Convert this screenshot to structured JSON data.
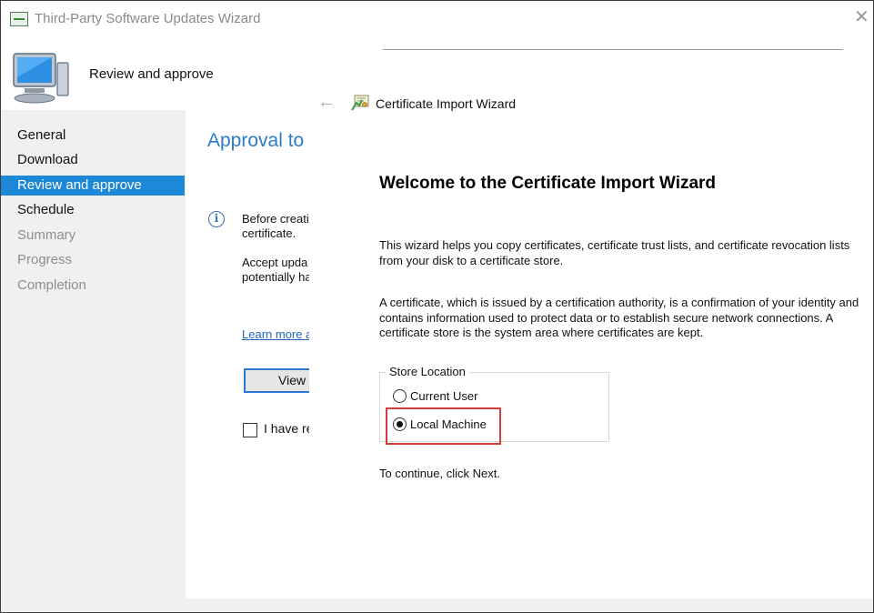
{
  "back_window": {
    "title": "Third-Party Software Updates Wizard",
    "close_glyph": "✕",
    "heading": "Review and approve",
    "nav": [
      {
        "label": "General",
        "state": "normal"
      },
      {
        "label": "Download",
        "state": "normal"
      },
      {
        "label": "Review and approve",
        "state": "active"
      },
      {
        "label": "Schedule",
        "state": "normal"
      },
      {
        "label": "Summary",
        "state": "disabled"
      },
      {
        "label": "Progress",
        "state": "disabled"
      },
      {
        "label": "Completion",
        "state": "disabled"
      }
    ],
    "main": {
      "page_title": "Approval to s",
      "info_glyph": "i",
      "info_line1": "Before creati",
      "info_line2": "certificate.",
      "accept_line1": "Accept upda",
      "accept_line2": "potentially ha",
      "learn_more": "Learn more a",
      "view_button": "View (",
      "checkbox_label": "I have re"
    }
  },
  "cert_wizard": {
    "back_glyph": "←",
    "title": "Certificate Import Wizard",
    "welcome": "Welcome to the Certificate Import Wizard",
    "para1": "This wizard helps you copy certificates, certificate trust lists, and certificate revocation lists from your disk to a certificate store.",
    "para2": "A certificate, which is issued by a certification authority, is a confirmation of your identity and contains information used to protect data or to establish secure network connections. A certificate store is the system area where certificates are kept.",
    "store_location": {
      "legend": "Store Location",
      "options": [
        {
          "label": "Current User",
          "selected": false
        },
        {
          "label": "Local Machine",
          "selected": true
        }
      ]
    },
    "continue_text": "To continue, click Next."
  },
  "colors": {
    "active_nav": "#1e88d8",
    "highlight": "#d23a3a",
    "title_blue": "#2b7cc7"
  },
  "icons": [
    "app-icon",
    "monitor-icon",
    "close-icon",
    "info-icon",
    "back-arrow-icon",
    "certificate-icon"
  ]
}
